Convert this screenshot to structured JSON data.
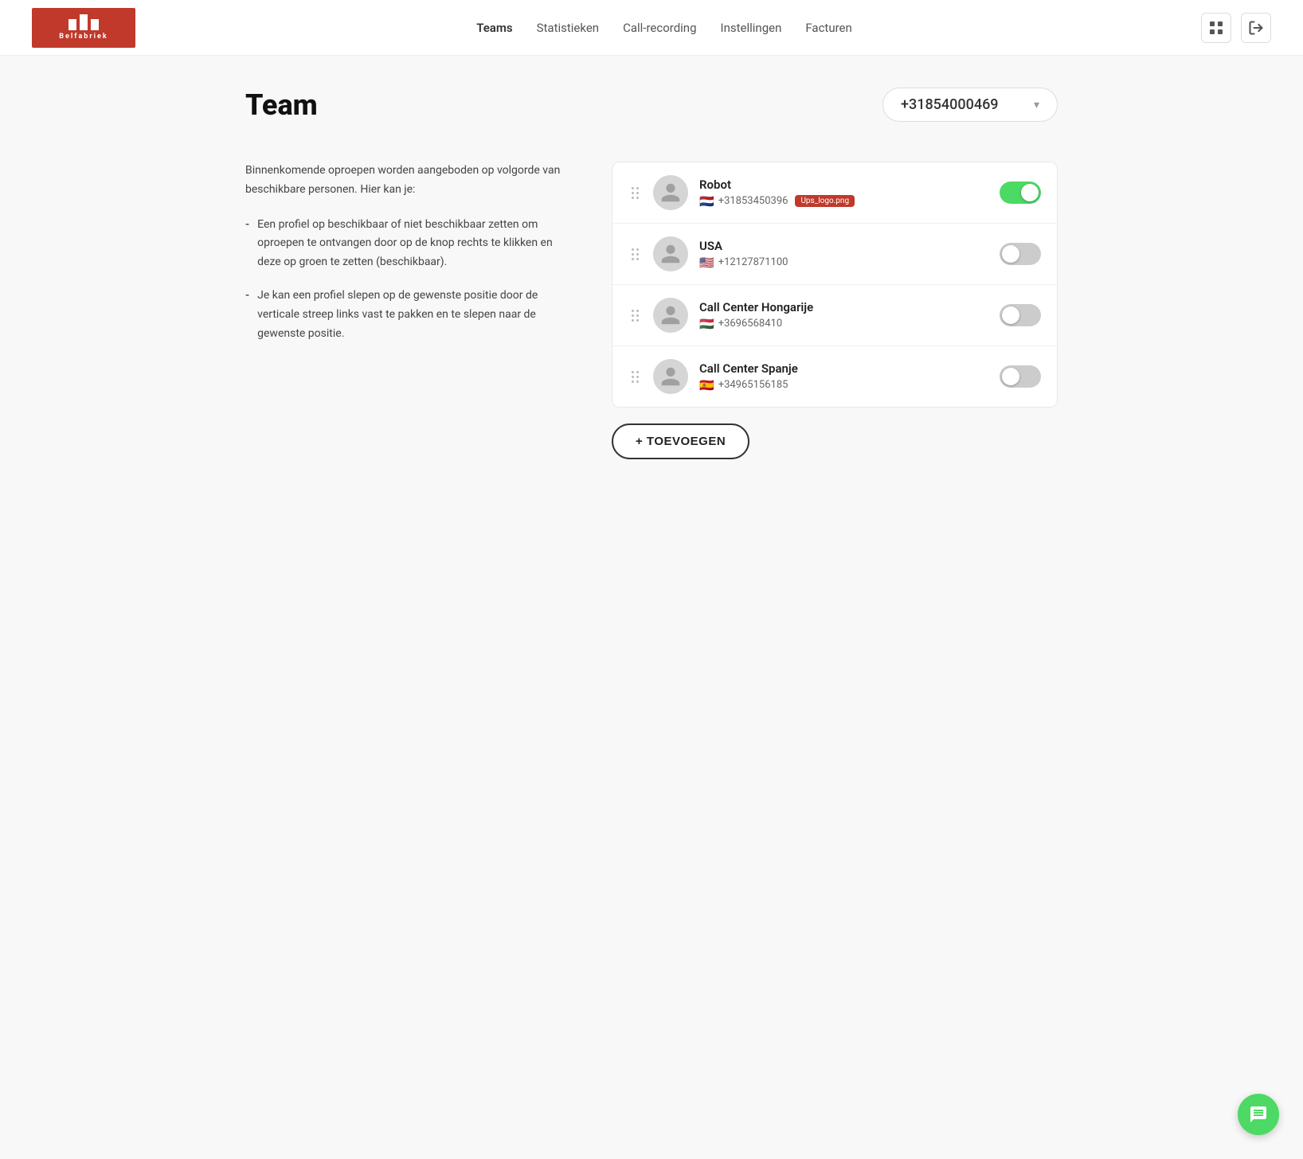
{
  "header": {
    "logo_alt": "Belfabriek",
    "nav_items": [
      {
        "label": "Teams",
        "active": true
      },
      {
        "label": "Statistieken",
        "active": false
      },
      {
        "label": "Call-recording",
        "active": false
      },
      {
        "label": "Instellingen",
        "active": false
      },
      {
        "label": "Facturen",
        "active": false
      }
    ],
    "icon_grid": "⊞",
    "icon_logout": "↪"
  },
  "page": {
    "title": "Team",
    "phone_number": "+31854000469"
  },
  "left_panel": {
    "intro": "Binnenkomende oproepen worden aangeboden op volgorde van beschikbare personen. Hier kan je:",
    "bullets": [
      {
        "dash": "-",
        "text": "Een profiel op beschikbaar of niet beschikbaar zetten om oproepen te ontvangen door op de knop rechts te klikken en deze op groen te zetten (beschikbaar)."
      },
      {
        "dash": "-",
        "text": "Je kan een profiel slepen op de gewenste positie door de verticale streep links vast te pakken en te slepen naar de gewenste positie."
      }
    ]
  },
  "team_items": [
    {
      "name": "Robot",
      "flag": "🇳🇱",
      "phone": "+31853450396",
      "enabled": true
    },
    {
      "name": "USA",
      "flag": "🇺🇸",
      "phone": "+12127871100",
      "enabled": false
    },
    {
      "name": "Call Center Hongarije",
      "flag": "🇭🇺",
      "phone": "+3696568410",
      "enabled": false
    },
    {
      "name": "Call Center Spanje",
      "flag": "🇪🇸",
      "phone": "+34965156185",
      "enabled": false
    }
  ],
  "add_button_label": "+ TOEVOEGEN",
  "upload_badge": "Ups_logo.png",
  "chat_icon_label": "chat"
}
